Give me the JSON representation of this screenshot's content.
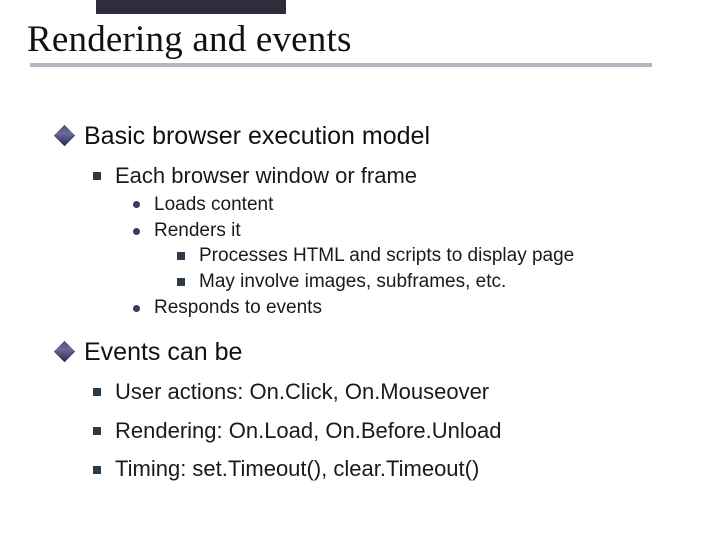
{
  "title": "Rendering and events",
  "sec1": {
    "head": "Basic browser execution model",
    "sub1": "Each browser window or frame",
    "b1": "Loads content",
    "b2": "Renders it",
    "b2a": "Processes HTML and scripts to display page",
    "b2b": "May involve images, subframes, etc.",
    "b3": "Responds to events"
  },
  "sec2": {
    "head": "Events can be",
    "b1": "User actions: On.Click, On.Mouseover",
    "b2": "Rendering: On.Load, On.Before.Unload",
    "b3": "Timing: set.Timeout(),  clear.Timeout()"
  }
}
